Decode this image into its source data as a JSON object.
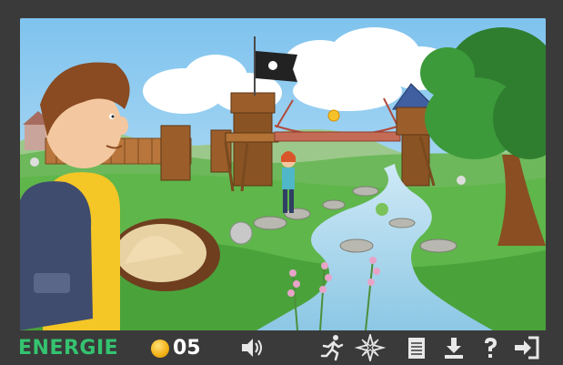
{
  "toolbar": {
    "energy_label": "ENERGIE",
    "coin_count": "05",
    "icons": {
      "sound": "speaker-icon",
      "action": "running-person-icon",
      "map": "compass-rose-icon",
      "notebook": "notebook-icon",
      "download": "download-icon",
      "help": "question-mark-icon",
      "exit": "exit-icon"
    },
    "colors": {
      "energy": "#34c36f",
      "coin": "#f3b51b",
      "icon": "#e8e8e8",
      "background": "#3a3a3a"
    }
  },
  "scene": {
    "flag_icon": "skull-flag-icon",
    "collectible_coin": "coin-icon"
  }
}
